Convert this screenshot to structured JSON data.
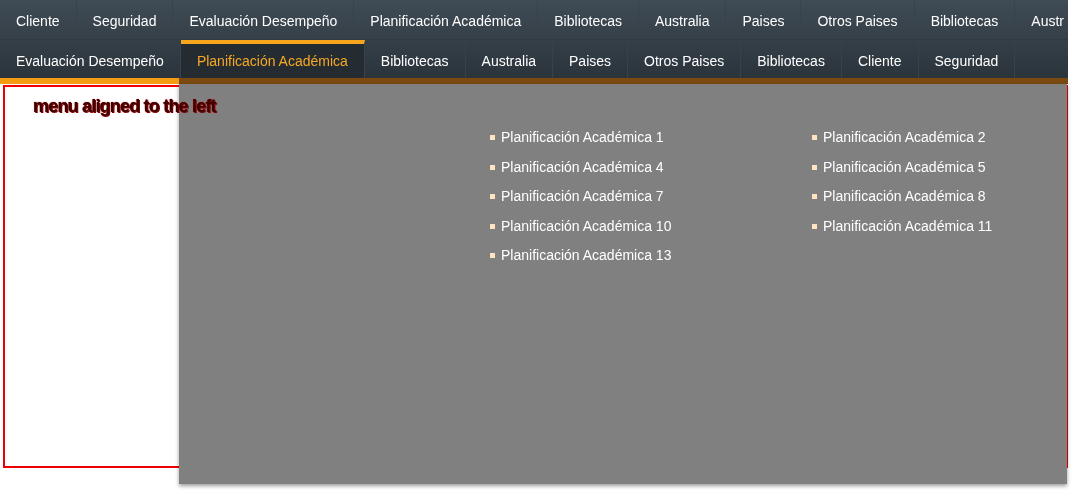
{
  "nav_rows": [
    {
      "items": [
        {
          "label": "Cliente",
          "selected": false
        },
        {
          "label": "Seguridad",
          "selected": false
        },
        {
          "label": "Evaluación Desempeño",
          "selected": false
        },
        {
          "label": "Planificación Académica",
          "selected": false
        },
        {
          "label": "Bibliotecas",
          "selected": false
        },
        {
          "label": "Australia",
          "selected": false
        },
        {
          "label": "Paises",
          "selected": false
        },
        {
          "label": "Otros Paises",
          "selected": false
        },
        {
          "label": "Bibliotecas",
          "selected": false
        },
        {
          "label": "Austr",
          "selected": false
        }
      ]
    },
    {
      "items": [
        {
          "label": "Evaluación Desempeño",
          "selected": false
        },
        {
          "label": "Planificación Académica",
          "selected": true
        },
        {
          "label": "Bibliotecas",
          "selected": false
        },
        {
          "label": "Australia",
          "selected": false
        },
        {
          "label": "Paises",
          "selected": false
        },
        {
          "label": "Otros Paises",
          "selected": false
        },
        {
          "label": "Bibliotecas",
          "selected": false
        },
        {
          "label": "Cliente",
          "selected": false
        },
        {
          "label": "Seguridad",
          "selected": false
        }
      ]
    }
  ],
  "heading": "menu aligned to the left",
  "dropdown": {
    "items": [
      "Planificación Académica 1",
      "Planificación Académica 2",
      "Planificación Académica 4",
      "Planificación Académica 5",
      "Planificación Académica 7",
      "Planificación Académica 8",
      "Planificación Académica 10",
      "Planificación Académica 11",
      "Planificación Académica 13"
    ]
  }
}
